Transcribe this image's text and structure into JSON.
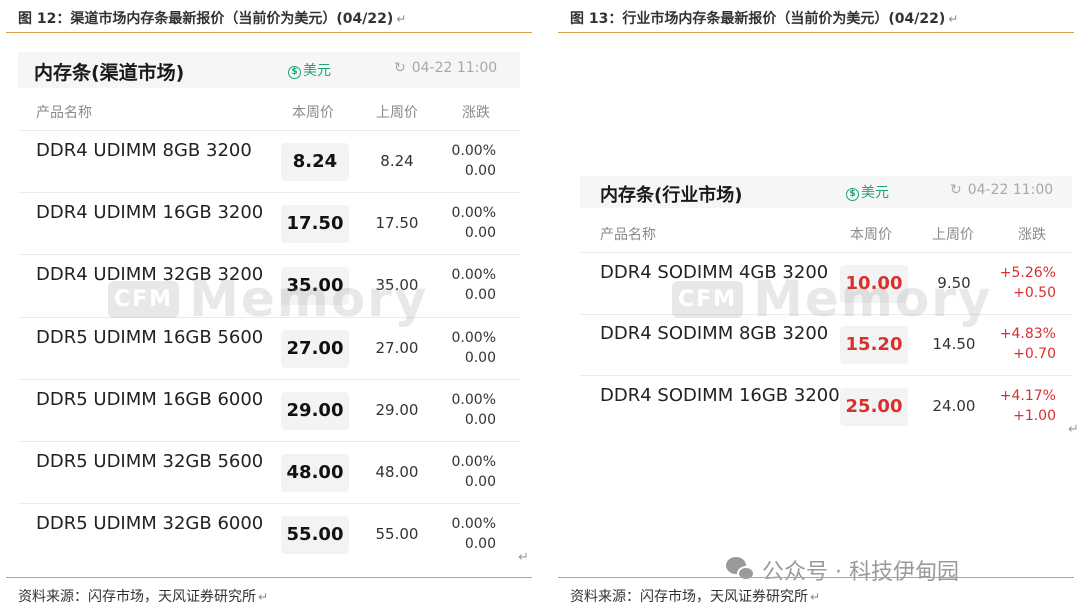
{
  "left": {
    "figure_title": "图 12：渠道市场内存条最新报价（当前价为美元）(04/22)",
    "return_mark": "↵",
    "panel_title": "内存条(渠道市场)",
    "currency_symbol": "$",
    "currency": "美元",
    "refresh_glyph": "↻",
    "update_time": "04-22 11:00",
    "columns": [
      "产品名称",
      "本周价",
      "上周价",
      "涨跌"
    ],
    "rows": [
      {
        "name": "DDR4 UDIMM 8GB 3200",
        "current": "8.24",
        "previous": "8.24",
        "pct": "0.00%",
        "abs": "0.00"
      },
      {
        "name": "DDR4 UDIMM 16GB 3200",
        "current": "17.50",
        "previous": "17.50",
        "pct": "0.00%",
        "abs": "0.00"
      },
      {
        "name": "DDR4 UDIMM 32GB 3200",
        "current": "35.00",
        "previous": "35.00",
        "pct": "0.00%",
        "abs": "0.00"
      },
      {
        "name": "DDR5 UDIMM 16GB 5600",
        "current": "27.00",
        "previous": "27.00",
        "pct": "0.00%",
        "abs": "0.00"
      },
      {
        "name": "DDR5 UDIMM 16GB 6000",
        "current": "29.00",
        "previous": "29.00",
        "pct": "0.00%",
        "abs": "0.00"
      },
      {
        "name": "DDR5 UDIMM 32GB 5600",
        "current": "48.00",
        "previous": "48.00",
        "pct": "0.00%",
        "abs": "0.00"
      },
      {
        "name": "DDR5 UDIMM 32GB 6000",
        "current": "55.00",
        "previous": "55.00",
        "pct": "0.00%",
        "abs": "0.00"
      }
    ],
    "source": "资料来源：闪存市场，天风证券研究所"
  },
  "right": {
    "figure_title": "图 13：行业市场内存条最新报价（当前价为美元）(04/22)",
    "return_mark": "↵",
    "panel_title": "内存条(行业市场)",
    "currency_symbol": "$",
    "currency": "美元",
    "refresh_glyph": "↻",
    "update_time": "04-22 11:00",
    "columns": [
      "产品名称",
      "本周价",
      "上周价",
      "涨跌"
    ],
    "rows": [
      {
        "name": "DDR4 SODIMM 4GB 3200",
        "current": "10.00",
        "previous": "9.50",
        "pct": "+5.26%",
        "abs": "+0.50"
      },
      {
        "name": "DDR4 SODIMM 8GB 3200",
        "current": "15.20",
        "previous": "14.50",
        "pct": "+4.83%",
        "abs": "+0.70"
      },
      {
        "name": "DDR4 SODIMM 16GB 3200",
        "current": "25.00",
        "previous": "24.00",
        "pct": "+4.17%",
        "abs": "+1.00"
      }
    ],
    "source": "资料来源：闪存市场，天风证券研究所"
  },
  "watermark": {
    "badge": "CFM",
    "text": "Memory"
  },
  "wechat_tag": "公众号 · 科技伊甸园",
  "colors": {
    "accent_rule": "#d4a04a",
    "up_red": "#d8302e",
    "currency_green": "#1fa27a"
  }
}
